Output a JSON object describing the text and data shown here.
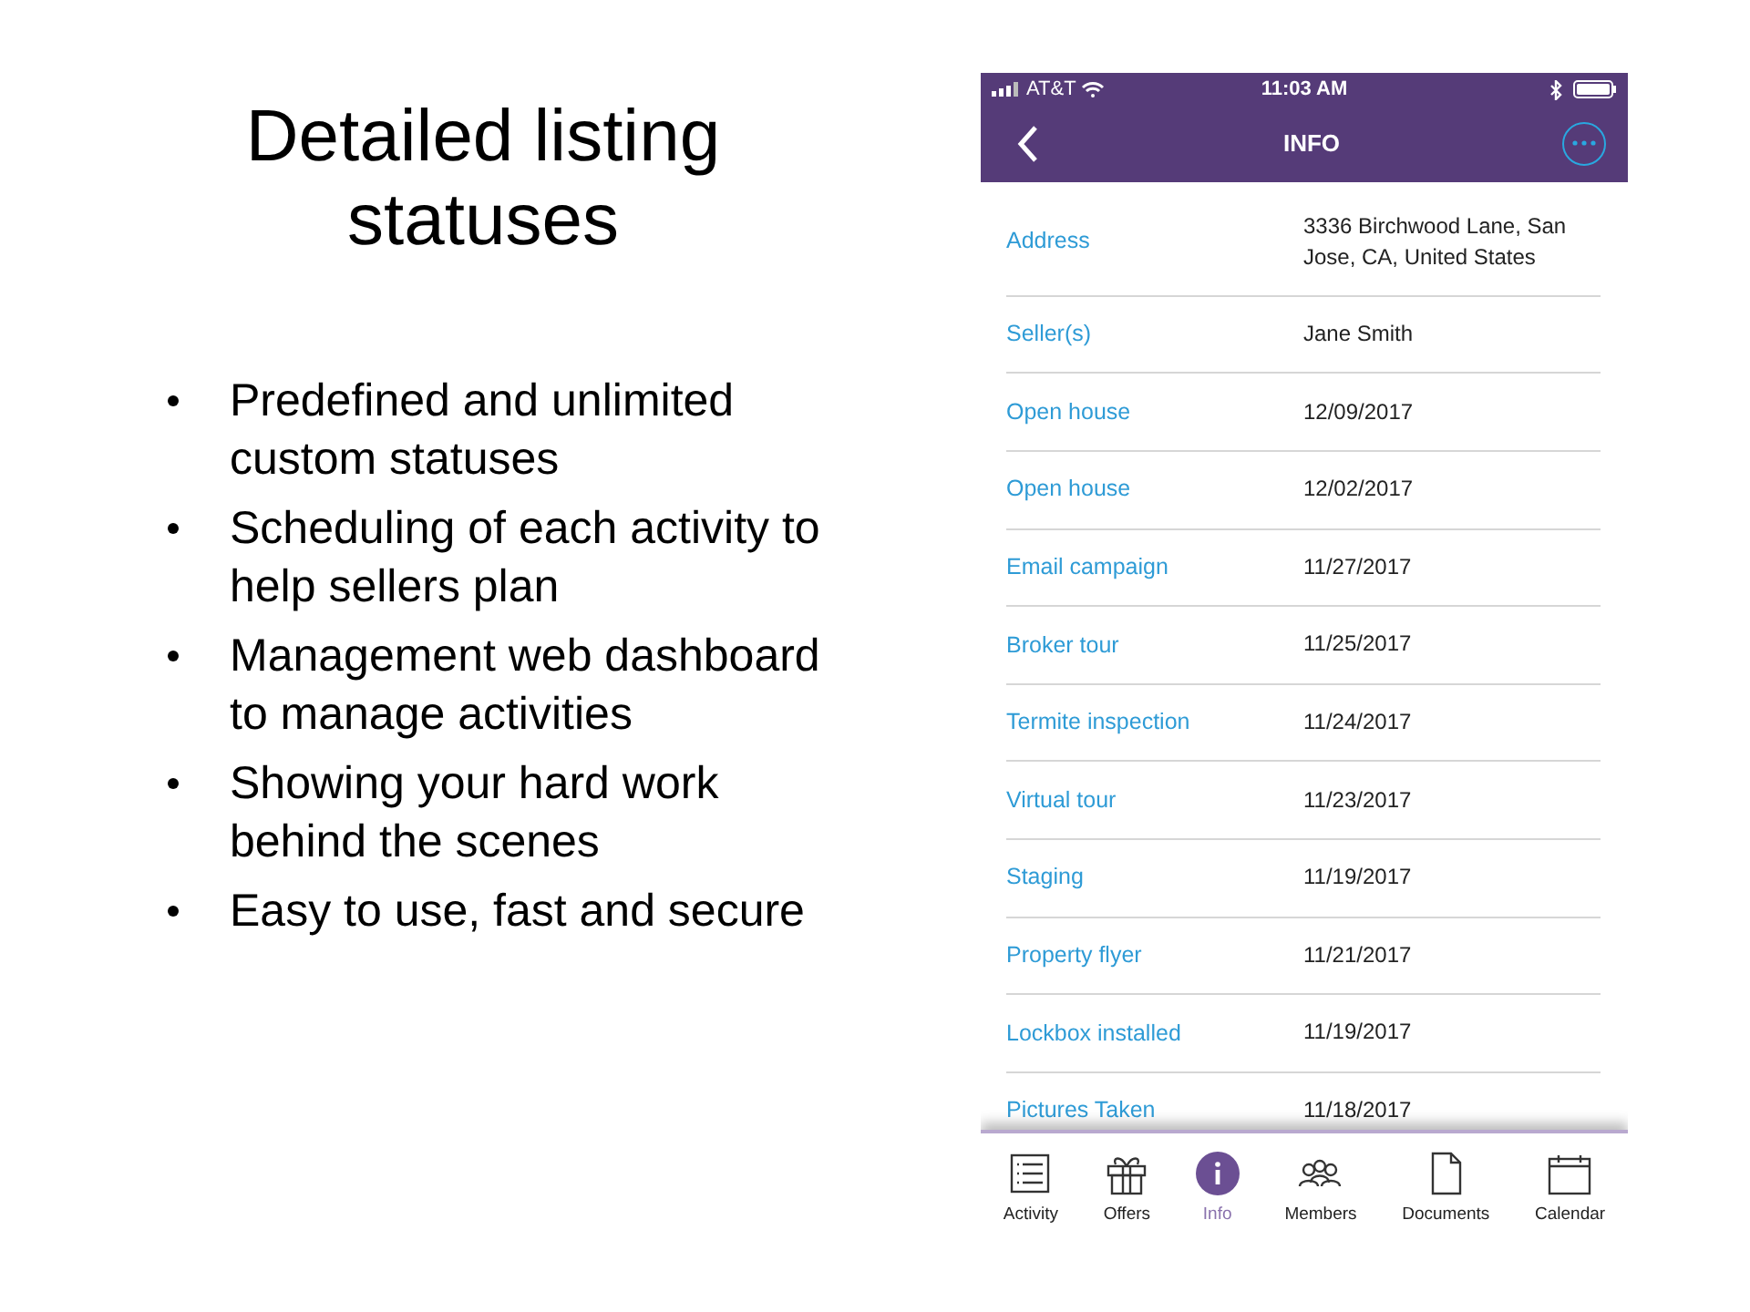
{
  "slide": {
    "title": "Detailed listing statuses",
    "bullets": [
      "Predefined and unlimited custom statuses",
      "Scheduling of each activity to help sellers plan",
      "Management web dashboard to manage activities",
      "Showing your hard work behind the scenes",
      "Easy to use, fast and secure"
    ]
  },
  "phone": {
    "status_bar": {
      "carrier": "AT&T",
      "time": "11:03 AM"
    },
    "nav": {
      "title": "INFO"
    },
    "rows": [
      {
        "label": "Address",
        "value": "3336 Birchwood Lane, San Jose, CA, United States"
      },
      {
        "label": "Seller(s)",
        "value": "Jane Smith"
      },
      {
        "label": "Open house",
        "value": "12/09/2017"
      },
      {
        "label": "Open house",
        "value": "12/02/2017"
      },
      {
        "label": "Email campaign",
        "value": "11/27/2017"
      },
      {
        "label": "Broker tour",
        "value": "11/25/2017"
      },
      {
        "label": "Termite inspection",
        "value": "11/24/2017"
      },
      {
        "label": "Virtual tour",
        "value": "11/23/2017"
      },
      {
        "label": "Staging",
        "value": "11/19/2017"
      },
      {
        "label": "Property flyer",
        "value": "11/21/2017"
      },
      {
        "label": "Lockbox installed",
        "value": "11/19/2017"
      },
      {
        "label": "Pictures Taken",
        "value": "11/18/2017"
      }
    ],
    "tabs": [
      {
        "label": "Activity",
        "kind": "activity",
        "selected": false
      },
      {
        "label": "Offers",
        "kind": "offers",
        "selected": false
      },
      {
        "label": "Info",
        "kind": "info",
        "selected": true
      },
      {
        "label": "Members",
        "kind": "members",
        "selected": false
      },
      {
        "label": "Documents",
        "kind": "documents",
        "selected": false
      },
      {
        "label": "Calendar",
        "kind": "calendar",
        "selected": false
      }
    ]
  }
}
